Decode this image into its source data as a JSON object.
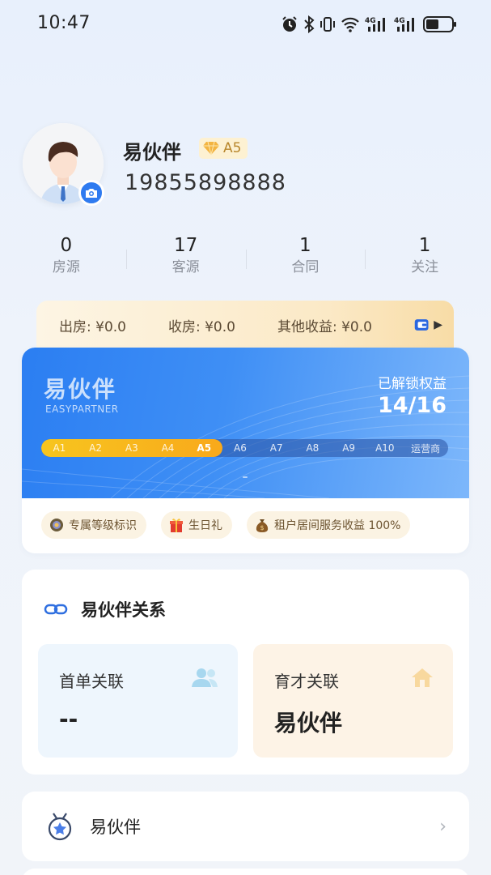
{
  "status_bar": {
    "time": "10:47",
    "signal_label_1": "4G",
    "signal_label_2": "4G"
  },
  "profile": {
    "name": "易伙伴",
    "level": "A5",
    "phone": "19855898888"
  },
  "stats": [
    {
      "value": "0",
      "label": "房源"
    },
    {
      "value": "17",
      "label": "客源"
    },
    {
      "value": "1",
      "label": "合同"
    },
    {
      "value": "1",
      "label": "关注"
    }
  ],
  "earnings": {
    "out": "出房: ¥0.0",
    "in": "收房: ¥0.0",
    "other": "其他收益: ¥0.0"
  },
  "level_card": {
    "brand": "易伙伴",
    "brand_sub": "EASYPARTNER",
    "unlock_label": "已解锁权益",
    "unlock_value": "14/16",
    "levels": [
      "A1",
      "A2",
      "A3",
      "A4",
      "A5",
      "A6",
      "A7",
      "A8",
      "A9",
      "A10",
      "运营商"
    ],
    "current_level_index": 4,
    "perks": [
      {
        "label": "专属等级标识",
        "icon": "medal-icon"
      },
      {
        "label": "生日礼",
        "icon": "gift-icon"
      },
      {
        "label": "租户居间服务收益 100%",
        "icon": "money-bag-icon"
      }
    ],
    "colors": {
      "hero_start": "#2b7ef2",
      "hero_end": "#7db7fb",
      "progress": "#f9a91b"
    }
  },
  "relations": {
    "title": "易伙伴关系",
    "first_order": {
      "label": "首单关联",
      "value": "--",
      "icon": "users-icon"
    },
    "mentor": {
      "label": "育才关联",
      "value": "易伙伴",
      "icon": "home-icon"
    }
  },
  "menu": [
    {
      "label": "易伙伴",
      "icon": "star-badge-icon"
    }
  ]
}
